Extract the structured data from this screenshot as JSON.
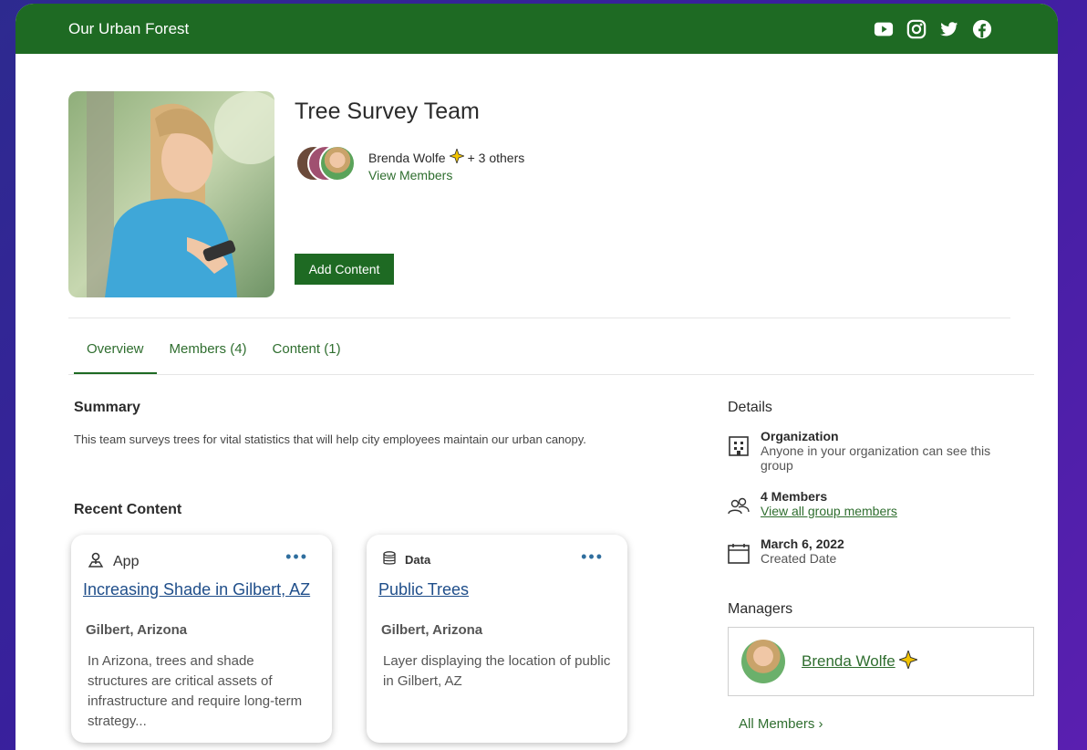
{
  "header": {
    "site_title": "Our Urban Forest",
    "social": [
      "youtube-icon",
      "instagram-icon",
      "twitter-icon",
      "facebook-icon"
    ]
  },
  "group": {
    "title": "Tree Survey Team",
    "owner_name": "Brenda Wolfe",
    "others_text": "+ 3 others",
    "view_members": "View Members",
    "add_content": "Add Content"
  },
  "tabs": [
    {
      "label": "Overview"
    },
    {
      "label": "Members (4)"
    },
    {
      "label": "Content (1)"
    }
  ],
  "summary": {
    "heading": "Summary",
    "text": "This team surveys trees for vital statistics that will help city employees maintain our urban canopy."
  },
  "recent": {
    "heading": "Recent Content",
    "cards": [
      {
        "type": "App",
        "more": "•••",
        "title": "Increasing Shade in Gilbert, AZ",
        "location": "Gilbert, Arizona",
        "description": "In Arizona, trees and shade structures are critical assets of infrastructure and require long-term strategy..."
      },
      {
        "type": "Data",
        "more": "•••",
        "title": "Public Trees",
        "location": "Gilbert, Arizona",
        "description": "Layer displaying the location of public in Gilbert, AZ"
      }
    ]
  },
  "details": {
    "heading": "Details",
    "org_title": "Organization",
    "org_sub": "Anyone in your organization can see this group",
    "members_title": "4 Members",
    "members_link": "View all group members",
    "date_title": "March 6, 2022",
    "date_sub": "Created Date"
  },
  "managers": {
    "heading": "Managers",
    "name": "Brenda Wolfe",
    "all_members": "All Members ›"
  },
  "colors": {
    "brand_green": "#1e6a23",
    "link_green": "#2f6e2f",
    "link_blue": "#1f4e8a",
    "background_purple": "#3a1f9e"
  }
}
